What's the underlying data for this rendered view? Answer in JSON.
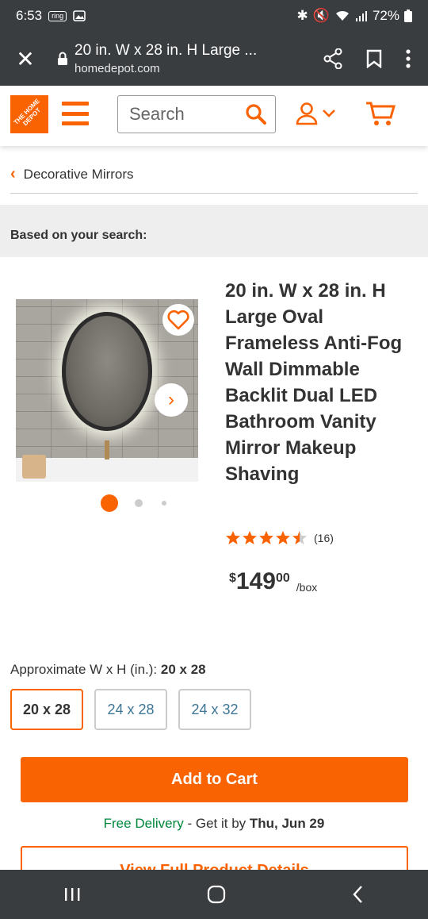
{
  "status": {
    "time": "6:53",
    "app_badge": "ring",
    "battery": "72%"
  },
  "browser": {
    "title": "20 in. W x 28 in. H Large ...",
    "domain": "homedepot.com"
  },
  "header": {
    "logo_text": "THE HOME DEPOT",
    "search_placeholder": "Search"
  },
  "breadcrumb": {
    "label": "Decorative Mirrors"
  },
  "section": {
    "heading": "Based on your search:"
  },
  "product": {
    "title": "20 in. W x 28 in. H Large Oval Frameless Anti-Fog Wall Dimmable Backlit Dual LED Bathroom Vanity Mirror Makeup Shaving",
    "rating_stars": 4.5,
    "review_count": "(16)",
    "price_currency": "$",
    "price_dollars": "149",
    "price_cents": "00",
    "price_unit": "/box"
  },
  "options": {
    "label": "Approximate W x H (in.):",
    "selected_value": "20 x 28",
    "items": [
      {
        "label": "20 x 28",
        "selected": true
      },
      {
        "label": "24 x 28",
        "selected": false
      },
      {
        "label": "24 x 32",
        "selected": false
      }
    ]
  },
  "actions": {
    "add_to_cart": "Add to Cart",
    "view_details": "View Full Product Details"
  },
  "delivery": {
    "free": "Free Delivery",
    "middle": " - Get it by ",
    "date": "Thu, Jun 29"
  },
  "colors": {
    "brand": "#f96302",
    "free_delivery": "#00873c",
    "option_text": "#3e7697"
  },
  "icons": [
    "close-icon",
    "lock-icon",
    "share-icon",
    "bookmark-icon",
    "more-icon",
    "hamburger-icon",
    "search-icon",
    "account-icon",
    "chevron-down-icon",
    "cart-icon",
    "chevron-left-icon",
    "heart-icon",
    "chevron-right-icon",
    "star-icon"
  ]
}
